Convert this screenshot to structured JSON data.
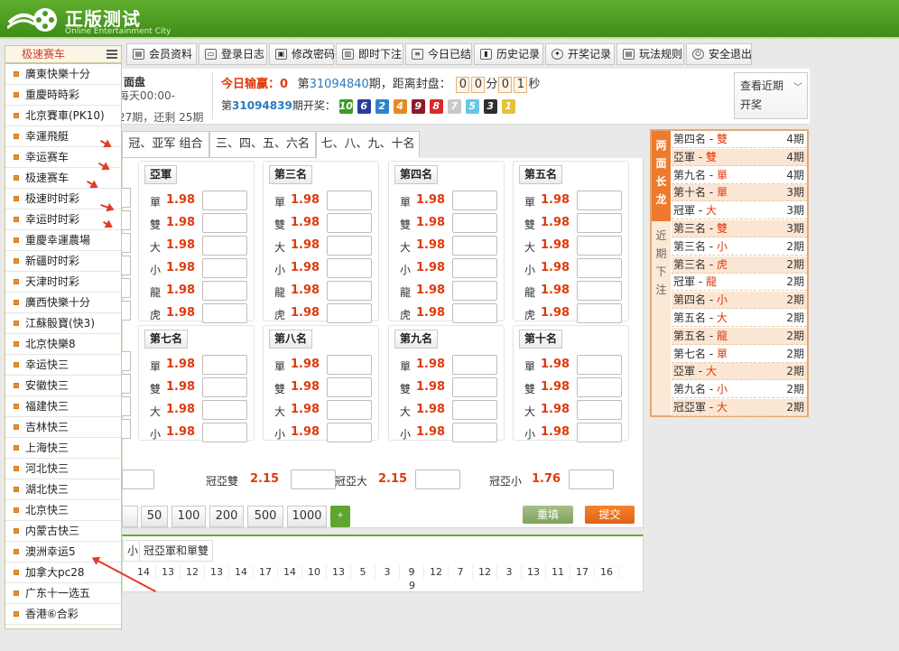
{
  "header": {
    "brand": "正版测试",
    "brand_sub": "Online Entertainment City"
  },
  "nav": [
    "会员资料",
    "登录日志",
    "修改密码",
    "即时下注",
    "今日已结",
    "历史记录",
    "开奖记录",
    "玩法规则",
    "安全退出"
  ],
  "lottery_select": {
    "current": "极速赛车"
  },
  "lottery_list": [
    "廣東快樂十分",
    "重慶時時彩",
    "北京賽車(PK10)",
    "幸運飛艇",
    "幸运赛车",
    "极速赛车",
    "极速时时彩",
    "幸运时时彩",
    "重慶幸運農場",
    "新疆时时彩",
    "天津时时彩",
    "廣西快樂十分",
    "江蘇骰寶(快3)",
    "北京快樂8",
    "幸运快三",
    "安徽快三",
    "福建快三",
    "吉林快三",
    "上海快三",
    "河北快三",
    "湖北快三",
    "北京快三",
    "内蒙古快三",
    "澳洲幸运5",
    "加拿大pc28",
    "广东十一选五",
    "香港⑥合彩"
  ],
  "info": {
    "panel_title": "面盘",
    "schedule": "每天00:00-",
    "issues_prefix": "27期，还剩",
    "issues_left": "25期",
    "today_label": "今日输赢：",
    "today_value": "0",
    "period_prefix": "第",
    "period_no": "31094840",
    "period_suffix": "期，距离封盘：",
    "countdown": [
      "0",
      "0",
      "分",
      "0",
      "1",
      "秒"
    ],
    "last_prefix": "第",
    "last_no": "31094839",
    "last_suffix": "期开奖：",
    "balls": [
      {
        "n": "10",
        "c": "#3c9a2a"
      },
      {
        "n": "6",
        "c": "#2b3d9c"
      },
      {
        "n": "2",
        "c": "#2b84c7"
      },
      {
        "n": "4",
        "c": "#e8891f"
      },
      {
        "n": "9",
        "c": "#8b1d28"
      },
      {
        "n": "8",
        "c": "#d92b2b"
      },
      {
        "n": "7",
        "c": "#c9c9c9"
      },
      {
        "n": "5",
        "c": "#67c7e8"
      },
      {
        "n": "3",
        "c": "#2f2f2f"
      },
      {
        "n": "1",
        "c": "#e6c23a"
      }
    ],
    "recent_label": "查看近期",
    "recent_sub": "开奖"
  },
  "tabs": [
    "冠、亚军 组合",
    "三、四、五、六名",
    "七、八、九、十名"
  ],
  "groups_top": [
    {
      "name": "亞軍",
      "rows": [
        [
          "單",
          "1.98"
        ],
        [
          "雙",
          "1.98"
        ],
        [
          "大",
          "1.98"
        ],
        [
          "小",
          "1.98"
        ],
        [
          "龍",
          "1.98"
        ],
        [
          "虎",
          "1.98"
        ]
      ]
    },
    {
      "name": "第三名",
      "rows": [
        [
          "單",
          "1.98"
        ],
        [
          "雙",
          "1.98"
        ],
        [
          "大",
          "1.98"
        ],
        [
          "小",
          "1.98"
        ],
        [
          "龍",
          "1.98"
        ],
        [
          "虎",
          "1.98"
        ]
      ]
    },
    {
      "name": "第四名",
      "rows": [
        [
          "單",
          "1.98"
        ],
        [
          "雙",
          "1.98"
        ],
        [
          "大",
          "1.98"
        ],
        [
          "小",
          "1.98"
        ],
        [
          "龍",
          "1.98"
        ],
        [
          "虎",
          "1.98"
        ]
      ]
    },
    {
      "name": "第五名",
      "rows": [
        [
          "單",
          "1.98"
        ],
        [
          "雙",
          "1.98"
        ],
        [
          "大",
          "1.98"
        ],
        [
          "小",
          "1.98"
        ],
        [
          "龍",
          "1.98"
        ],
        [
          "虎",
          "1.98"
        ]
      ]
    }
  ],
  "groups_bottom": [
    {
      "name": "第七名",
      "rows": [
        [
          "單",
          "1.98"
        ],
        [
          "雙",
          "1.98"
        ],
        [
          "大",
          "1.98"
        ],
        [
          "小",
          "1.98"
        ]
      ]
    },
    {
      "name": "第八名",
      "rows": [
        [
          "單",
          "1.98"
        ],
        [
          "雙",
          "1.98"
        ],
        [
          "大",
          "1.98"
        ],
        [
          "小",
          "1.98"
        ]
      ]
    },
    {
      "name": "第九名",
      "rows": [
        [
          "單",
          "1.98"
        ],
        [
          "雙",
          "1.98"
        ],
        [
          "大",
          "1.98"
        ],
        [
          "小",
          "1.98"
        ]
      ]
    },
    {
      "name": "第十名",
      "rows": [
        [
          "單",
          "1.98"
        ],
        [
          "雙",
          "1.98"
        ],
        [
          "大",
          "1.98"
        ],
        [
          "小",
          "1.98"
        ]
      ]
    }
  ],
  "pair_bets": [
    {
      "label": "冠亞雙",
      "odds": "2.15"
    },
    {
      "label": "冠亞大",
      "odds": "2.15"
    },
    {
      "label": "冠亞小",
      "odds": "1.76"
    }
  ],
  "amounts": [
    "50",
    "100",
    "200",
    "500",
    "1000"
  ],
  "plus_label": "+",
  "reset_label": "重填",
  "submit_label": "提交",
  "results": {
    "tab_a": "小",
    "tab_b": "冠亞軍和單雙",
    "row1": [
      "14",
      "13",
      "12",
      "13",
      "14",
      "17",
      "14",
      "10",
      "13",
      "5",
      "3",
      "9",
      "12",
      "7",
      "12",
      "3",
      "13",
      "11",
      "17",
      "16"
    ],
    "row2_value": "9"
  },
  "long_dragon": {
    "title": [
      "两",
      "面",
      "长",
      "龙"
    ],
    "side2": [
      "近",
      "期",
      "下",
      "注"
    ],
    "rows": [
      {
        "pos": "第四名",
        "val": "雙",
        "n": "4期"
      },
      {
        "pos": "亞軍",
        "val": "雙",
        "n": "4期"
      },
      {
        "pos": "第九名",
        "val": "單",
        "n": "4期"
      },
      {
        "pos": "第十名",
        "val": "單",
        "n": "3期"
      },
      {
        "pos": "冠軍",
        "val": "大",
        "n": "3期"
      },
      {
        "pos": "第三名",
        "val": "雙",
        "n": "3期"
      },
      {
        "pos": "第三名",
        "val": "小",
        "n": "2期"
      },
      {
        "pos": "第三名",
        "val": "虎",
        "n": "2期"
      },
      {
        "pos": "冠軍",
        "val": "龍",
        "n": "2期"
      },
      {
        "pos": "第四名",
        "val": "小",
        "n": "2期"
      },
      {
        "pos": "第五名",
        "val": "大",
        "n": "2期"
      },
      {
        "pos": "第五名",
        "val": "龍",
        "n": "2期"
      },
      {
        "pos": "第七名",
        "val": "單",
        "n": "2期"
      },
      {
        "pos": "亞軍",
        "val": "大",
        "n": "2期"
      },
      {
        "pos": "第九名",
        "val": "小",
        "n": "2期"
      },
      {
        "pos": "冠亞軍",
        "val": "大",
        "n": "2期"
      }
    ]
  }
}
